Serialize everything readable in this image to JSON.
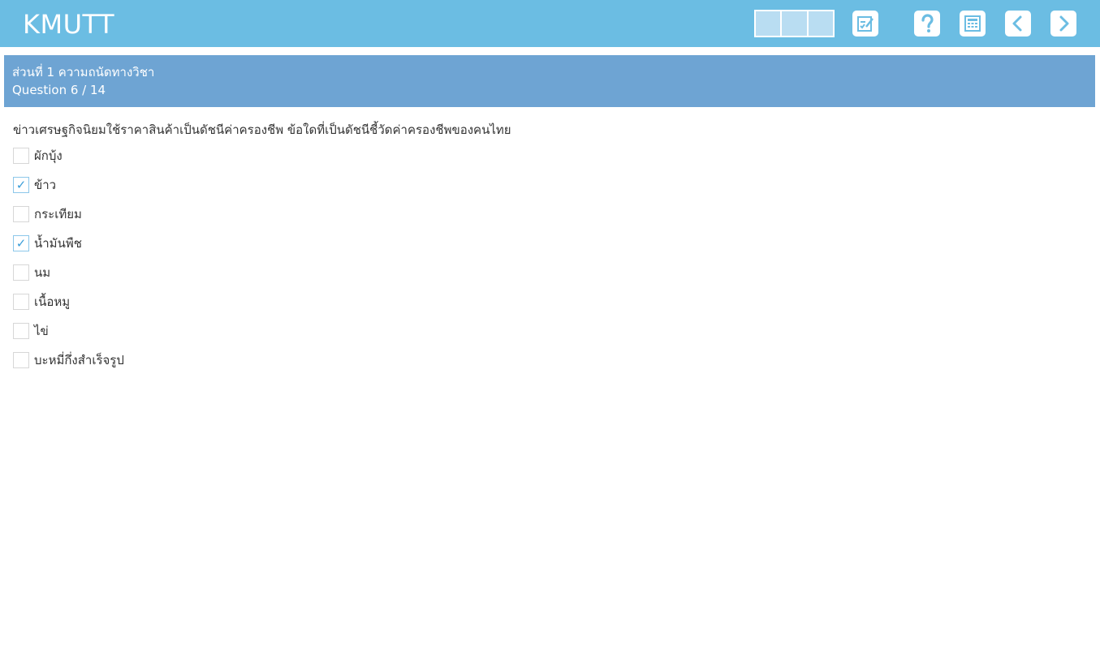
{
  "header": {
    "logo": "KMUTT",
    "progress_segments": 3,
    "buttons": [
      {
        "name": "review-button",
        "icon": "edit-checklist-icon"
      },
      {
        "name": "help-button",
        "icon": "question-mark-icon"
      },
      {
        "name": "calculator-button",
        "icon": "calculator-icon"
      },
      {
        "name": "previous-button",
        "icon": "chevron-left-icon"
      },
      {
        "name": "next-button",
        "icon": "chevron-right-icon"
      }
    ]
  },
  "section": {
    "title": "ส่วนที่ 1 ความถนัดทางวิชา",
    "counter": "Question 6 / 14"
  },
  "question": {
    "text": "ข่าวเศรษฐกิจนิยมใช้ราคาสินค้าเป็นดัชนีค่าครองชีพ ข้อใดที่เป็นดัชนีชี้วัดค่าครองชีพของคนไทย",
    "options": [
      {
        "label": "ผักบุ้ง",
        "checked": false
      },
      {
        "label": "ข้าว",
        "checked": true
      },
      {
        "label": "กระเทียม",
        "checked": false
      },
      {
        "label": "น้ำมันพืช",
        "checked": true
      },
      {
        "label": "นม",
        "checked": false
      },
      {
        "label": "เนื้อหมู",
        "checked": false
      },
      {
        "label": "ไข่",
        "checked": false
      },
      {
        "label": "บะหมี่กึ่งสำเร็จรูป",
        "checked": false
      }
    ],
    "check_mark": "✓"
  },
  "colors": {
    "topbar": "#6bbde3",
    "section_header": "#6ea4d3",
    "progress_fill": "#b9ddf2",
    "check": "#3a9dd8"
  }
}
